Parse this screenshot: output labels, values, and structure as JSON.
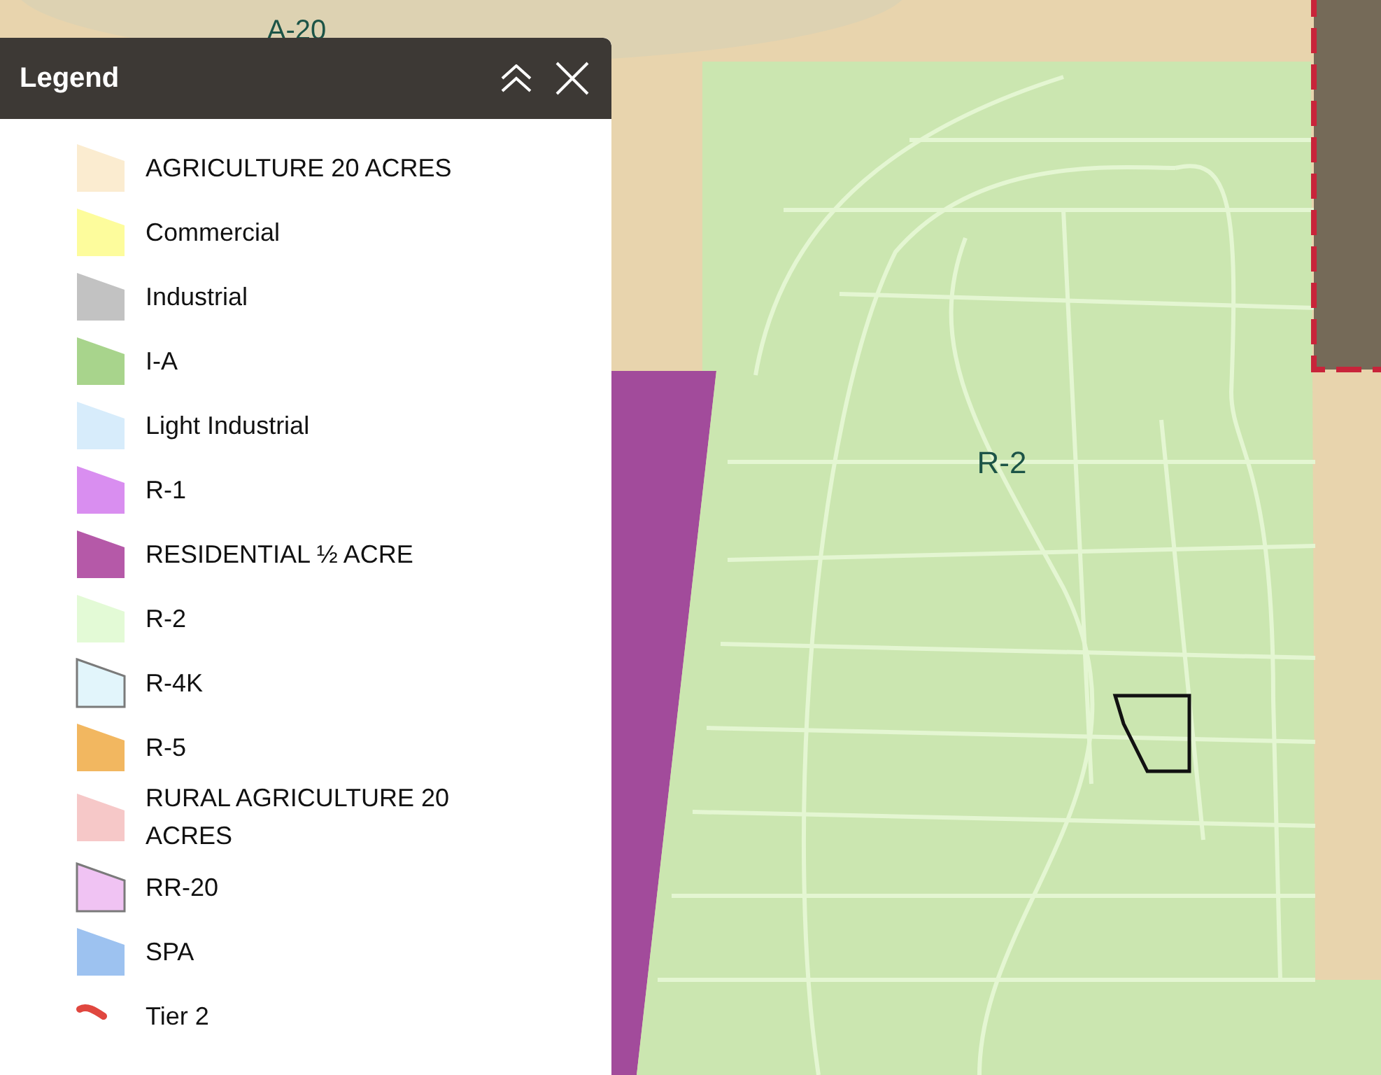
{
  "map": {
    "labels": [
      {
        "text": "A-20",
        "kind": "zone"
      },
      {
        "text": "R-2",
        "kind": "zone"
      }
    ]
  },
  "legend": {
    "title": "Legend",
    "items": [
      {
        "label": "AGRICULTURE 20 ACRES",
        "kind": "polygon",
        "color": "#fbecd0",
        "outlined": false
      },
      {
        "label": "Commercial",
        "kind": "polygon",
        "color": "#fdfc9c",
        "outlined": false
      },
      {
        "label": "Industrial",
        "kind": "polygon",
        "color": "#c2c2c2",
        "outlined": false
      },
      {
        "label": "I-A",
        "kind": "polygon",
        "color": "#a8d48c",
        "outlined": false
      },
      {
        "label": "Light Industrial",
        "kind": "polygon",
        "color": "#d7ecfb",
        "outlined": false
      },
      {
        "label": "R-1",
        "kind": "polygon",
        "color": "#d98ef0",
        "outlined": false
      },
      {
        "label": "RESIDENTIAL ½ ACRE",
        "kind": "polygon",
        "color": "#b559a8",
        "outlined": false
      },
      {
        "label": "R-2",
        "kind": "polygon",
        "color": "#e3fad6",
        "outlined": false
      },
      {
        "label": "R-4K",
        "kind": "polygon",
        "color": "#e2f5fb",
        "outlined": true
      },
      {
        "label": "R-5",
        "kind": "polygon",
        "color": "#f2b760",
        "outlined": false
      },
      {
        "label": "RURAL AGRICULTURE 20 ACRES",
        "kind": "polygon",
        "color": "#f6c8c8",
        "outlined": false
      },
      {
        "label": "RR-20",
        "kind": "polygon",
        "color": "#f0c3f3",
        "outlined": true
      },
      {
        "label": "SPA",
        "kind": "polygon",
        "color": "#9dc2f0",
        "outlined": false
      },
      {
        "label": "Tier 2",
        "kind": "line",
        "color": "#e0473f"
      }
    ]
  }
}
